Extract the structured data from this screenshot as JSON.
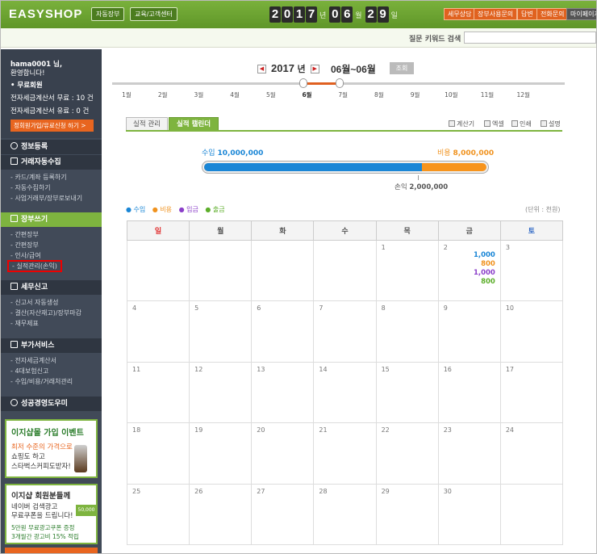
{
  "topbar": {
    "logo": "EASYSHOP",
    "nav_buttons": [
      "자동장부",
      "교육/고객센터"
    ],
    "date": {
      "year_digits": [
        "2",
        "0",
        "1",
        "7"
      ],
      "year_unit": "년",
      "month_digits": [
        "0",
        "6"
      ],
      "month_unit": "월",
      "day_digits": [
        "2",
        "9"
      ],
      "day_unit": "일"
    },
    "right_buttons": [
      "세무상담",
      "장부사용문의",
      "답변",
      "전화문의",
      "마이페이지"
    ]
  },
  "search": {
    "label": "질문 키워드 검색",
    "placeholder": ""
  },
  "sidebar": {
    "greeting_line1": "hama0001 님,",
    "greeting_line2": "환영합니다!",
    "member_type": "• 무료회원",
    "invoice_free": "전자세금계산서 무료 : 10 건",
    "invoice_paid": "전자세금계산서 유료 : 0 건",
    "join_button": "정회원가입/유료신청 하기 >",
    "sections": [
      {
        "title": "정보등록",
        "items": []
      },
      {
        "title": "거래자동수집",
        "items": [
          "카드/계좌 등록하기",
          "자동수집하기",
          "사업거래부/장부로보내기"
        ]
      },
      {
        "title": "장부쓰기",
        "items": [
          "간편장부",
          "간편장부",
          "인사/급여",
          "실적관리(손익)"
        ]
      },
      {
        "title": "세무신고",
        "items": [
          "신고서 자동생성",
          "결산(자산재고)/장부마감",
          "재무제표"
        ]
      },
      {
        "title": "부가서비스",
        "items": [
          "전자세금계산서",
          "4대보험신고",
          "수입/비용/거래처관리"
        ]
      },
      {
        "title": "성공경영도우미",
        "items": []
      }
    ],
    "ad1": {
      "title": "이지샵몰 가입 이벤트",
      "line1": "최저 수준의 가격으로",
      "line2": "쇼핑도 하고",
      "line3": "스타벅스커피도받자!"
    },
    "ad2": {
      "title": "이지샵 회원분들께",
      "line1": "네이버 검색광고",
      "line2": "무료쿠폰을 드립니다!",
      "coupon": "50,000",
      "line3": "5만원 무료광고쿠폰 증정",
      "line4": "3개월간 광고비 15% 적립"
    }
  },
  "main": {
    "year": "2017",
    "year_unit": "년",
    "range": "06월~06월",
    "view_button": "조회",
    "months": [
      "1월",
      "2월",
      "3월",
      "4월",
      "5월",
      "6월",
      "7월",
      "8월",
      "9월",
      "10월",
      "11월",
      "12월"
    ],
    "selected_month_index": 5,
    "tabs": [
      "실적 관리",
      "실적 캘린더"
    ],
    "active_tab": 1,
    "tools": [
      "계산기",
      "엑셀",
      "인쇄",
      "설명"
    ],
    "summary": {
      "income_label": "수입",
      "income_value": "10,000,000",
      "expense_label": "비용",
      "expense_value": "8,000,000",
      "profit_label": "손익",
      "profit_value": "2,000,000",
      "income_fraction": 0.77
    },
    "legend": [
      "● 수입",
      "● 비용",
      "● 입금",
      "● 출금"
    ],
    "legend_colors": [
      "#1a86d6",
      "#f0921e",
      "#8b3fc9",
      "#5cae2a"
    ],
    "unit": "(단위 : 천원)",
    "weekdays": [
      "일",
      "월",
      "화",
      "수",
      "목",
      "금",
      "토"
    ],
    "weeks": [
      [
        "",
        "",
        "",
        "",
        "1",
        "2",
        "3"
      ],
      [
        "4",
        "5",
        "6",
        "7",
        "8",
        "9",
        "10"
      ],
      [
        "11",
        "12",
        "13",
        "14",
        "15",
        "16",
        "17"
      ],
      [
        "18",
        "19",
        "20",
        "21",
        "22",
        "23",
        "24"
      ],
      [
        "25",
        "26",
        "27",
        "28",
        "29",
        "30",
        ""
      ]
    ],
    "day2_values": {
      "income": "1,000",
      "expense": "800",
      "deposit": "1,000",
      "withdraw": "800"
    }
  }
}
